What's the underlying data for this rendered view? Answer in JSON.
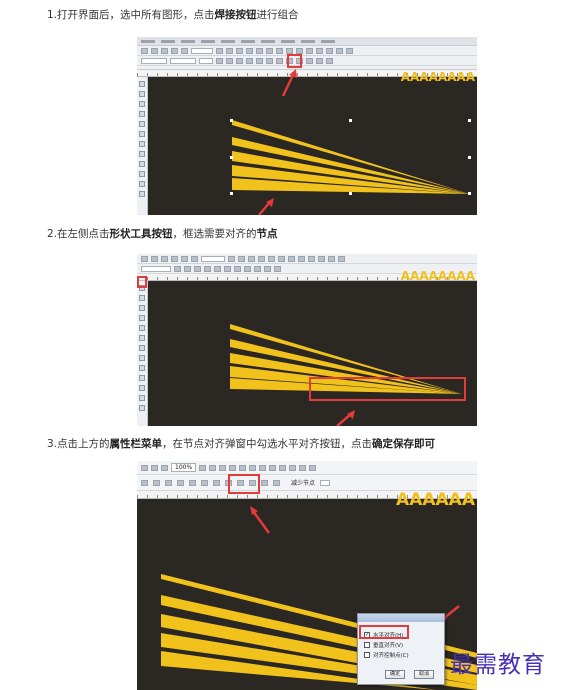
{
  "steps": [
    {
      "number": "1.",
      "parts": [
        {
          "text": "打开界面后，选中所有图形，点击",
          "bold": false
        },
        {
          "text": "焊接按钮",
          "bold": true
        },
        {
          "text": "进行组合",
          "bold": false
        }
      ]
    },
    {
      "number": "2.",
      "parts": [
        {
          "text": "在左侧点击",
          "bold": false
        },
        {
          "text": "形状工具按钮",
          "bold": true
        },
        {
          "text": "，框选需要对齐的",
          "bold": false
        },
        {
          "text": "节点",
          "bold": true
        }
      ]
    },
    {
      "number": "3.",
      "parts": [
        {
          "text": "点击上方的",
          "bold": false
        },
        {
          "text": "属性栏菜单",
          "bold": true
        },
        {
          "text": "，在节点对齐弹窗中勾选水平对齐按钮，点击",
          "bold": false
        },
        {
          "text": "确定保存即可",
          "bold": true
        }
      ]
    }
  ],
  "screenshots": {
    "shot1": {
      "canvas_text": "AAAAAAAA"
    },
    "shot2": {
      "canvas_text": "AAAAAAAA"
    },
    "shot3": {
      "canvas_text": "AAAAAA",
      "zoom_value": "100%",
      "property_label": "减少节点",
      "dialog": {
        "option_horizontal": "水平对齐(H)",
        "option_vertical": "垂直对齐(V)",
        "option_control": "对齐控制点(C)",
        "ok_label": "确定",
        "cancel_label": "取消"
      }
    }
  },
  "watermark": "最需教育",
  "colors": {
    "canvas_bg": "#2b2722",
    "stripe": "#f2c21c",
    "highlight": "#e23b3b",
    "watermark": "#4630b8"
  }
}
